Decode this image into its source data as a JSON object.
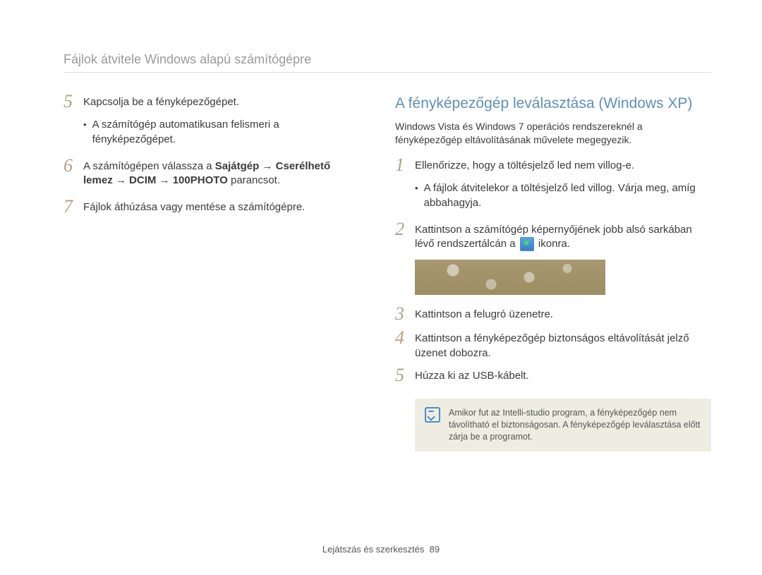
{
  "header": {
    "title": "Fájlok átvitele Windows alapú számítógépre"
  },
  "left": {
    "steps": [
      {
        "num": "5",
        "text": "Kapcsolja be a fényképezőgépet.",
        "bullets": [
          "A számítógép automatikusan felismeri a fényképezőgépet."
        ]
      },
      {
        "num": "6",
        "prefix": "A számítógépen válassza a ",
        "bold1": "Sajátgép",
        "arrow1": " → ",
        "bold2": "Cserélhető lemez",
        "arrow2": " → ",
        "bold3": "DCIM",
        "arrow3": " → ",
        "bold4": "100PHOTO",
        "suffix": " parancsot."
      },
      {
        "num": "7",
        "text": "Fájlok áthúzása vagy mentése a számítógépre."
      }
    ]
  },
  "right": {
    "heading": "A fényképezőgép leválasztása (Windows XP)",
    "intro": "Windows Vista és Windows 7 operációs rendszereknél a fényképezőgép eltávolításának művelete megegyezik.",
    "steps": [
      {
        "num": "1",
        "text": "Ellenőrizze, hogy a töltésjelző led nem villog-e.",
        "bullets": [
          "A fájlok átvitelekor a töltésjelző led villog. Várja meg, amíg abbahagyja."
        ]
      },
      {
        "num": "2",
        "part_a": "Kattintson a számítógép képernyőjének jobb alsó sarkában lévő rendszertálcán a ",
        "part_b": " ikonra."
      },
      {
        "num": "3",
        "text": "Kattintson a felugró üzenetre."
      },
      {
        "num": "4",
        "text": "Kattintson a fényképezőgép biztonságos eltávolítását jelző üzenet dobozra."
      },
      {
        "num": "5",
        "text": "Húzza ki az USB-kábelt."
      }
    ],
    "note": "Amikor fut az Intelli-studio program, a fényképezőgép nem távolítható el biztonságosan. A fényképezőgép leválasztása előtt zárja be a programot."
  },
  "footer": {
    "section": "Lejátszás és szerkesztés",
    "page": "89"
  }
}
